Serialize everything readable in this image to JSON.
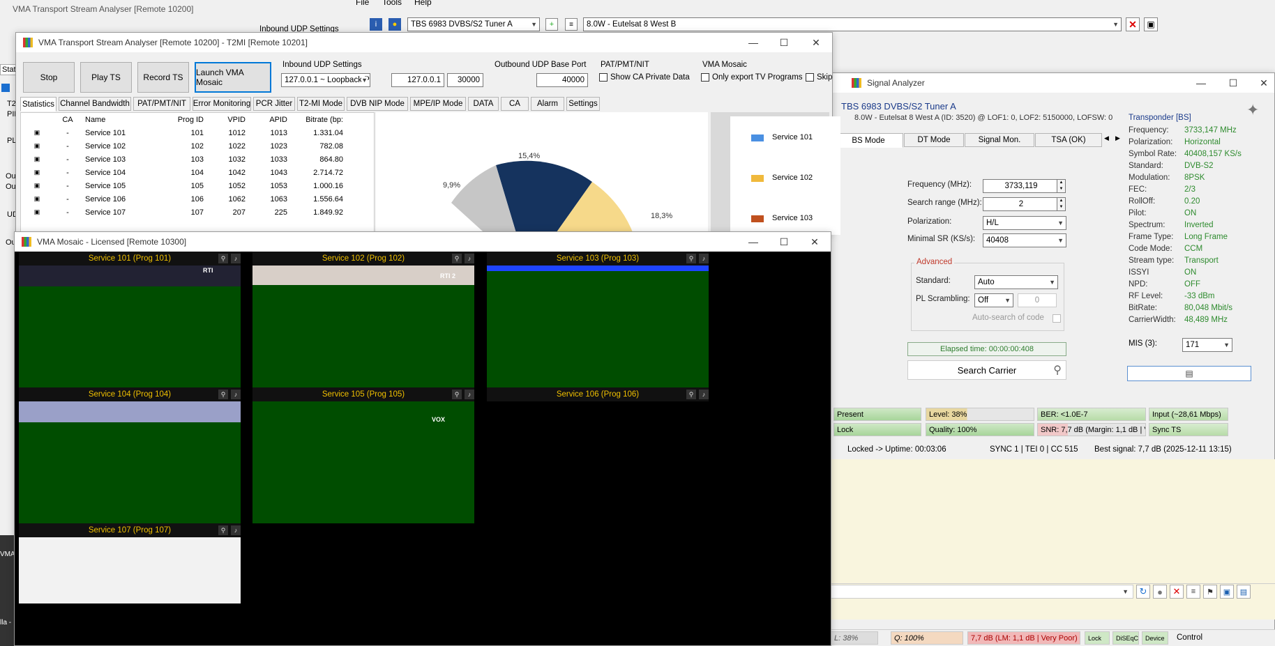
{
  "bg_window": {
    "title": "VMA Transport Stream Analyser  [Remote 10200]",
    "inbound_label": "Inbound UDP Settings",
    "statistics_tab": "Statisti",
    "side_labels": [
      "T2-",
      "PID",
      "PLI",
      "Out",
      "Out",
      "UD",
      "Ou"
    ],
    "taskbar_text": [
      "VMA D",
      "lla -"
    ]
  },
  "top_app": {
    "menu": [
      "File",
      "Tools",
      "Help"
    ],
    "tuner": "TBS 6983 DVBS/S2 Tuner A",
    "satellite": "8.0W - Eutelsat 8 West B"
  },
  "ts_window": {
    "title": "VMA Transport Stream Analyser  [Remote 10200] - T2MI  [Remote 10201]",
    "buttons": [
      "Stop",
      "Play TS",
      "Record TS",
      "Launch VMA Mosaic"
    ],
    "inbound": {
      "label": "Inbound UDP Settings",
      "interface": "127.0.0.1 ~ Loopback Pse",
      "ip": "127.0.0.1",
      "port": "30000"
    },
    "outbound": {
      "label": "Outbound UDP Base Port",
      "port": "40000"
    },
    "patpmt": {
      "label": "PAT/PMT/NIT",
      "check": "Show CA Private Data"
    },
    "mosaic": {
      "label": "VMA Mosaic",
      "check": "Only export TV Programs",
      "skip": "Skip"
    },
    "tabs": [
      "Statistics",
      "Channel Bandwidth",
      "PAT/PMT/NIT",
      "Error Monitoring",
      "PCR Jitter",
      "T2-MI Mode",
      "DVB NIP Mode",
      "MPE/IP Mode",
      "DATA",
      "CA",
      "Alarm",
      "Settings"
    ],
    "columns": [
      "CA",
      "Name",
      "Prog ID",
      "VPID",
      "APID",
      "Bitrate (bp:"
    ],
    "rows": [
      [
        "-",
        "Service 101",
        "101",
        "1012",
        "1013",
        "1.331.04"
      ],
      [
        "-",
        "Service 102",
        "102",
        "1022",
        "1023",
        "782.08"
      ],
      [
        "-",
        "Service 103",
        "103",
        "1032",
        "1033",
        "864.80"
      ],
      [
        "-",
        "Service 104",
        "104",
        "1042",
        "1043",
        "2.714.72"
      ],
      [
        "-",
        "Service 105",
        "105",
        "1052",
        "1053",
        "1.000.16"
      ],
      [
        "-",
        "Service 106",
        "106",
        "1062",
        "1063",
        "1.556.64"
      ],
      [
        "-",
        "Service 107",
        "107",
        "207",
        "225",
        "1.849.92"
      ]
    ],
    "pie_labels": [
      "15,4%",
      "9,9%",
      "18,3%"
    ],
    "legend": [
      "Service 101",
      "Service 102",
      "Service 103"
    ]
  },
  "mosaic_window": {
    "title": "VMA Mosaic - Licensed  [Remote 10300]",
    "tiles": [
      "Service 101 (Prog 101)",
      "Service 102 (Prog 102)",
      "Service 103 (Prog 103)",
      "Service 104 (Prog 104)",
      "Service 105 (Prog 105)",
      "Service 106 (Prog 106)",
      "Service 107 (Prog 107)"
    ],
    "logos": [
      "RTI",
      "RTI 2",
      "VOX"
    ]
  },
  "signal_window": {
    "title": "Signal Analyzer",
    "tuner": "TBS 6983 DVBS/S2 Tuner A",
    "sub": "8.0W - Eutelsat 8 West A (ID: 3520) @ LOF1: 0, LOF2: 5150000, LOFSW: 0",
    "tabs": [
      "BS Mode",
      "DT Mode",
      "Signal Mon.",
      "TSA (OK)"
    ],
    "freq_label": "Frequency (MHz):",
    "freq": "3733,119",
    "range_label": "Search range (MHz):",
    "range": "2",
    "pol_label": "Polarization:",
    "pol": "H/L",
    "sr_label": "Minimal SR (KS/s):",
    "sr": "40408",
    "advanced": "Advanced",
    "std_label": "Standard:",
    "std": "Auto",
    "pls_label": "PL Scrambling:",
    "pls": "Off",
    "pls_code": "0",
    "auto_label": "Auto-search of code",
    "elapsed": "Elapsed time: 00:00:00:408",
    "search_btn": "Search Carrier",
    "transponder_title": "Transponder [BS]",
    "transponder": [
      [
        "Frequency:",
        "3733,147 MHz"
      ],
      [
        "Polarization:",
        "Horizontal"
      ],
      [
        "Symbol Rate:",
        "40408,157 KS/s"
      ],
      [
        "Standard:",
        "DVB-S2"
      ],
      [
        "Modulation:",
        "8PSK"
      ],
      [
        "FEC:",
        "2/3"
      ],
      [
        "RollOff:",
        "0.20"
      ],
      [
        "Pilot:",
        "ON"
      ],
      [
        "Spectrum:",
        "Inverted"
      ],
      [
        "Frame Type:",
        "Long Frame"
      ],
      [
        "Code Mode:",
        "CCM"
      ],
      [
        "Stream type:",
        "Transport"
      ],
      [
        "ISSYI",
        "ON"
      ],
      [
        "NPD:",
        "OFF"
      ],
      [
        "RF Level:",
        "-33 dBm"
      ],
      [
        "BitRate:",
        "80,048 Mbit/s"
      ],
      [
        "CarrierWidth:",
        "48,489 MHz"
      ]
    ],
    "mis_label": "MIS (3):",
    "mis": "171",
    "status": {
      "present": "Present",
      "level": "Level: 38%",
      "ber": "BER: <1.0E-7",
      "input": "Input (~28,61 Mbps)",
      "lock": "Lock",
      "quality": "Quality: 100%",
      "snr": "SNR: 7,7 dB (Margin: 1,1 dB | Ver...",
      "sync": "Sync TS"
    },
    "locked": "Locked -> Uptime: 00:03:06",
    "sync_info": "SYNC 1 | TEI 0 | CC 515",
    "best": "Best signal: 7,7 dB (2025-12-11 13:15)",
    "bottom": {
      "level": "L: 38%",
      "q": "Q: 100%",
      "snr": "7,7 dB (LM: 1,1 dB | Very Poor)",
      "lock": "Lock",
      "diseqc": "DiSEqC",
      "device": "Device",
      "control": "Control"
    }
  }
}
